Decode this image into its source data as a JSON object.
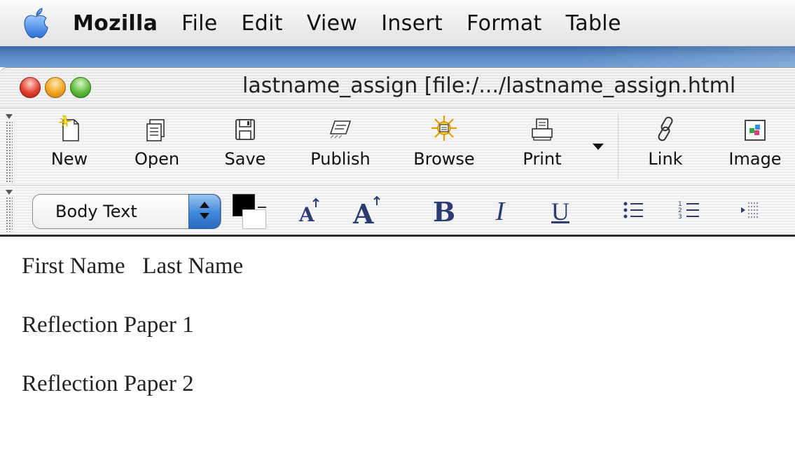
{
  "menubar": {
    "apple_icon": "apple-icon",
    "items": [
      "Mozilla",
      "File",
      "Edit",
      "View",
      "Insert",
      "Format",
      "Table"
    ]
  },
  "window": {
    "title": "lastname_assign [file:/.../lastname_assign.html"
  },
  "toolbar": {
    "buttons": [
      {
        "label": "New",
        "icon": "new-document-icon"
      },
      {
        "label": "Open",
        "icon": "open-icon"
      },
      {
        "label": "Save",
        "icon": "save-icon"
      },
      {
        "label": "Publish",
        "icon": "publish-icon"
      },
      {
        "label": "Browse",
        "icon": "browse-icon"
      },
      {
        "label": "Print",
        "icon": "print-icon"
      },
      {
        "label": "Link",
        "icon": "link-icon"
      },
      {
        "label": "Image",
        "icon": "image-icon"
      }
    ]
  },
  "format_bar": {
    "paragraph_style": "Body Text",
    "text_color": "#000000",
    "background_color": "#ffffff",
    "bold": "B",
    "italic": "I",
    "underline": "U"
  },
  "content": {
    "lines": [
      "First Name   Last Name",
      "Reflection Paper 1",
      "Reflection Paper 2"
    ]
  },
  "colors": {
    "desktop_blue": "#4a7cbc",
    "format_glyph": "#2b3c72"
  }
}
